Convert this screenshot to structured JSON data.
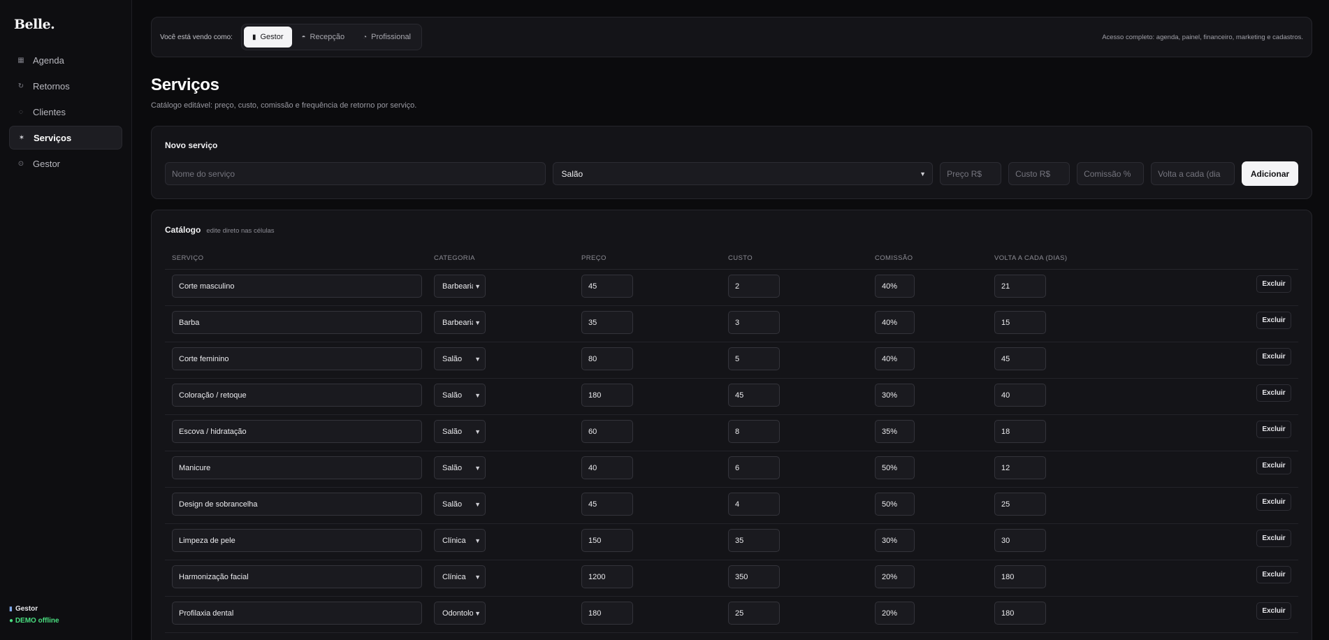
{
  "sidebar": {
    "brand": "Belle.",
    "items": [
      {
        "icon": "▦",
        "label": "Agenda",
        "active": false
      },
      {
        "icon": "↻",
        "label": "Retornos",
        "active": false
      },
      {
        "icon": "◌",
        "label": "Clientes",
        "active": false
      },
      {
        "icon": "✶",
        "label": "Serviços",
        "active": true
      },
      {
        "icon": "⊙",
        "label": "Gestor",
        "active": false
      }
    ],
    "role_icon": "▮",
    "role": "Gestor",
    "status": "● DEMO offline"
  },
  "rolebar": {
    "label": "Você está vendo como:",
    "roles": [
      {
        "icon": "▮",
        "label": "Gestor",
        "selected": true
      },
      {
        "icon": "◓",
        "label": "Recepção",
        "selected": false
      },
      {
        "icon": "◔",
        "label": "Profissional",
        "selected": false
      }
    ],
    "description": "Acesso completo: agenda, painel, financeiro, marketing e cadastros."
  },
  "page": {
    "title": "Serviços",
    "subtitle": "Catálogo editável: preço, custo, comissão e frequência de retorno por serviço."
  },
  "new_service": {
    "title": "Novo serviço",
    "name_placeholder": "Nome do serviço",
    "category_value": "Salão",
    "price_placeholder": "Preço R$",
    "cost_placeholder": "Custo R$",
    "commission_placeholder": "Comissão %",
    "return_placeholder": "Volta a cada (dia",
    "add_label": "Adicionar"
  },
  "catalog": {
    "title": "Catálogo",
    "hint": "edite direto nas células",
    "columns": [
      "SERVIÇO",
      "CATEGORIA",
      "PREÇO",
      "CUSTO",
      "COMISSÃO",
      "VOLTA A CADA (DIAS)"
    ],
    "delete_label": "Excluir",
    "rows": [
      {
        "name": "Corte masculino",
        "category": "Barbearia",
        "price": "45",
        "cost": "2",
        "commission": "40%",
        "return_days": "21"
      },
      {
        "name": "Barba",
        "category": "Barbearia",
        "price": "35",
        "cost": "3",
        "commission": "40%",
        "return_days": "15"
      },
      {
        "name": "Corte feminino",
        "category": "Salão",
        "price": "80",
        "cost": "5",
        "commission": "40%",
        "return_days": "45"
      },
      {
        "name": "Coloração / retoque",
        "category": "Salão",
        "price": "180",
        "cost": "45",
        "commission": "30%",
        "return_days": "40"
      },
      {
        "name": "Escova / hidratação",
        "category": "Salão",
        "price": "60",
        "cost": "8",
        "commission": "35%",
        "return_days": "18"
      },
      {
        "name": "Manicure",
        "category": "Salão",
        "price": "40",
        "cost": "6",
        "commission": "50%",
        "return_days": "12"
      },
      {
        "name": "Design de sobrancelha",
        "category": "Salão",
        "price": "45",
        "cost": "4",
        "commission": "50%",
        "return_days": "25"
      },
      {
        "name": "Limpeza de pele",
        "category": "Clínica",
        "price": "150",
        "cost": "35",
        "commission": "30%",
        "return_days": "30"
      },
      {
        "name": "Harmonização facial",
        "category": "Clínica",
        "price": "1200",
        "cost": "350",
        "commission": "20%",
        "return_days": "180"
      },
      {
        "name": "Profilaxia dental",
        "category": "Odontologia",
        "price": "180",
        "cost": "25",
        "commission": "20%",
        "return_days": "180"
      }
    ]
  }
}
